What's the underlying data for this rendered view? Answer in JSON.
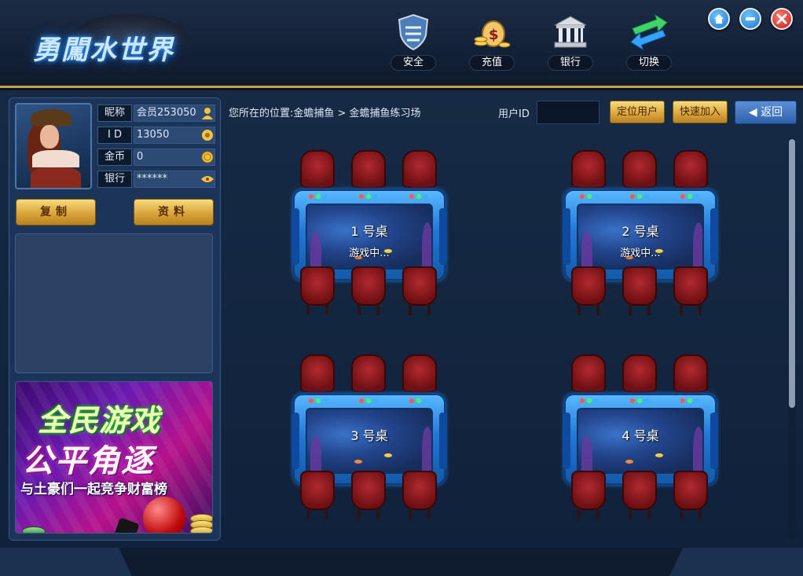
{
  "app": {
    "logo_text": "勇闖水世界"
  },
  "nav": [
    {
      "label": "安全",
      "icon": "shield-icon"
    },
    {
      "label": "充值",
      "icon": "money-bag-icon"
    },
    {
      "label": "银行",
      "icon": "bank-icon"
    },
    {
      "label": "切换",
      "icon": "switch-arrows-icon"
    }
  ],
  "window_controls": [
    "home-icon",
    "minimize-icon",
    "close-icon"
  ],
  "profile": {
    "nickname_label": "昵称",
    "nickname": "会员253050",
    "id_label": "I D",
    "id": "13050",
    "coins_label": "金币",
    "coins": "0",
    "bank_label": "银行",
    "bank": "******",
    "copy_button": "复制",
    "info_button": "资料"
  },
  "banner": {
    "line1": "全民游戏",
    "line2": "公平角逐",
    "line3": "与土豪们一起竞争财富榜"
  },
  "toolbar": {
    "breadcrumb": "您所在的位置:金蟾捕鱼 > 金蟾捕鱼练习场",
    "user_id_label": "用户ID",
    "user_id_value": "",
    "locate_button": "定位用户",
    "quick_join_button": "快速加入",
    "back_button": "返回"
  },
  "tables": [
    {
      "name": "1 号桌",
      "status": "游戏中..."
    },
    {
      "name": "2 号桌",
      "status": "游戏中..."
    },
    {
      "name": "3 号桌",
      "status": ""
    },
    {
      "name": "4 号桌",
      "status": ""
    }
  ],
  "colors": {
    "accent_gold": "#d9a43a",
    "frame_blue": "#2478d6",
    "background": "#10213a"
  }
}
